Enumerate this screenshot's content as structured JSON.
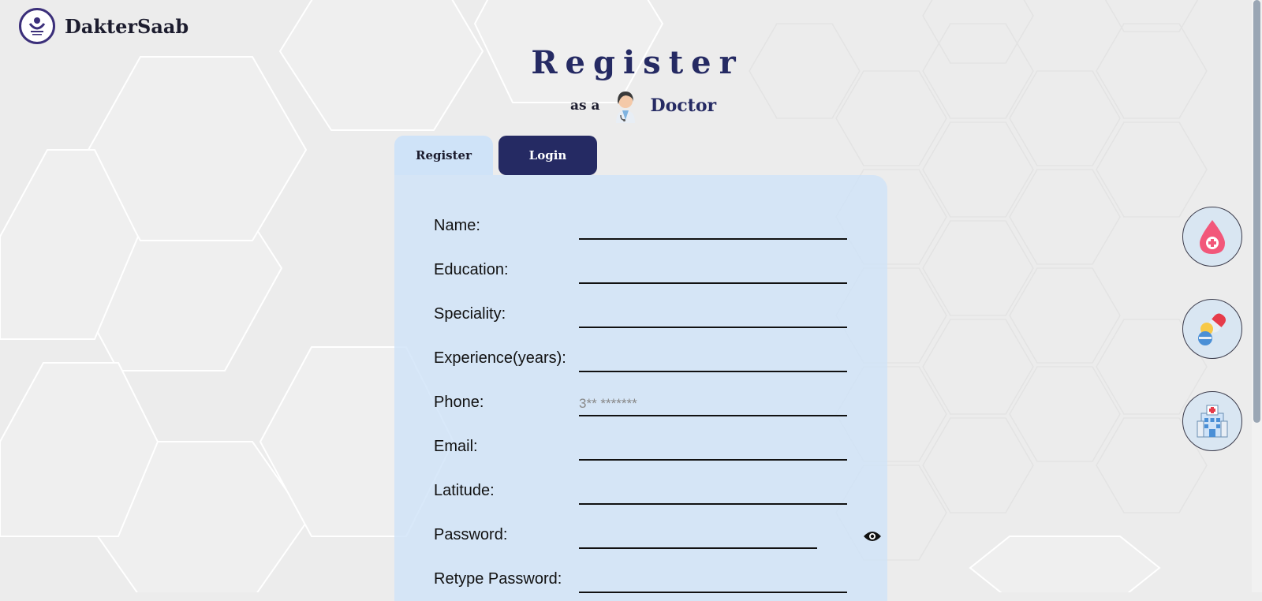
{
  "brand": {
    "name": "DakterSaab"
  },
  "heading": {
    "title": "Register",
    "prefix": "as a",
    "role": "Doctor"
  },
  "tabs": {
    "register": "Register",
    "login": "Login"
  },
  "form": {
    "fields": [
      {
        "label": "Name:",
        "value": "",
        "placeholder": ""
      },
      {
        "label": "Education:",
        "value": "",
        "placeholder": ""
      },
      {
        "label": "Speciality:",
        "value": "",
        "placeholder": ""
      },
      {
        "label": "Experience(years):",
        "value": "",
        "placeholder": ""
      },
      {
        "label": "Phone:",
        "value": "",
        "placeholder": "3** *******"
      },
      {
        "label": "Email:",
        "value": "",
        "placeholder": ""
      },
      {
        "label": "Latitude:",
        "value": "",
        "placeholder": ""
      },
      {
        "label": "Password:",
        "value": "",
        "placeholder": ""
      },
      {
        "label": "Retype Password:",
        "value": "",
        "placeholder": ""
      }
    ]
  },
  "side_buttons": [
    "blood-drop-icon",
    "pills-icon",
    "hospital-icon"
  ],
  "colors": {
    "accent": "#252a63",
    "tab_light": "#cfe3f8",
    "card": "#cfe3f8"
  }
}
